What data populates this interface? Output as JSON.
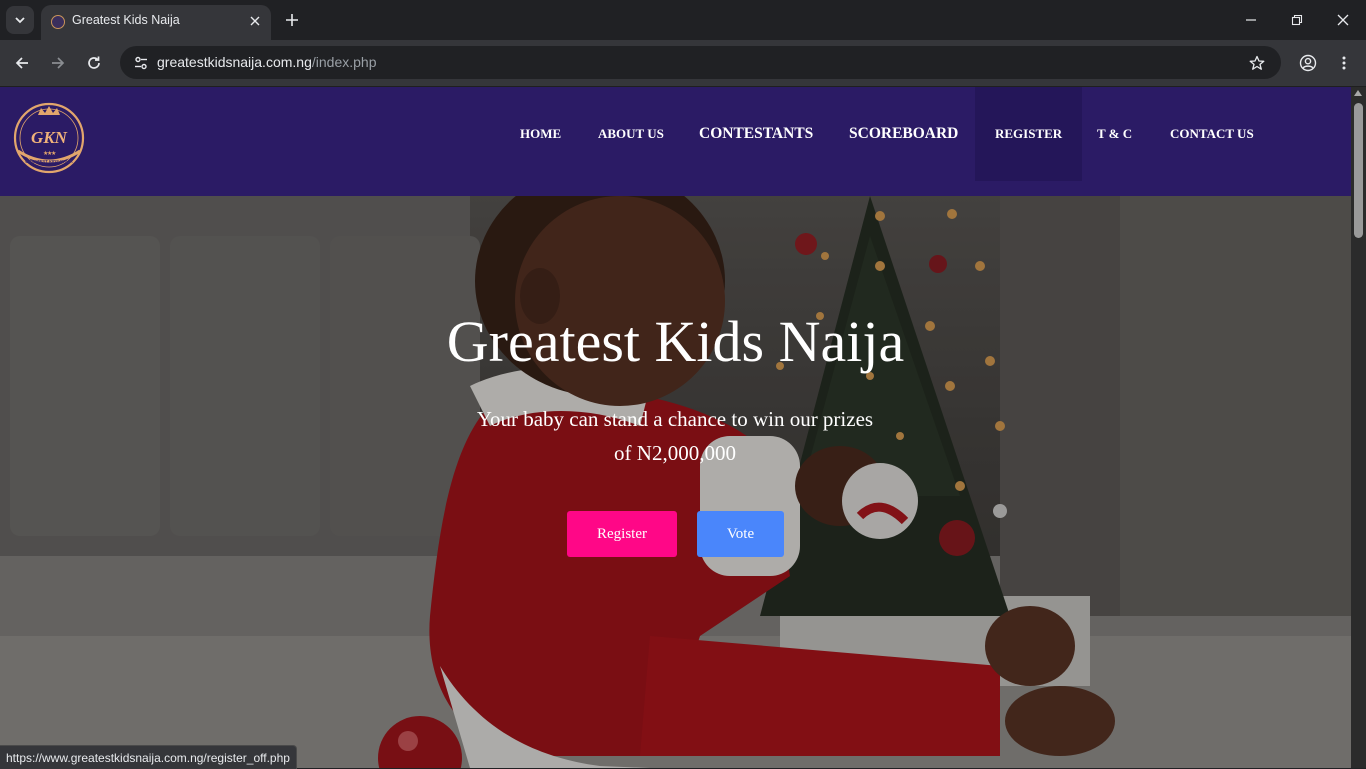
{
  "browser": {
    "tab_title": "Greatest Kids Naija",
    "url_host": "greatestkidsnaija.com.ng",
    "url_path": "/index.php",
    "status_url": "https://www.greatestkidsnaija.com.ng/register_off.php"
  },
  "site": {
    "logo_text": "GKN",
    "logo_caption": "GREATEST KIDS NAIJA",
    "nav": {
      "home": "HOME",
      "about": "ABOUT US",
      "contestants": "CONTESTANTS",
      "scoreboard": "SCOREBOARD",
      "register": "REGISTER",
      "tc": "T & C",
      "contact": "CONTACT US"
    },
    "colors": {
      "navbar": "#2b1b65",
      "register_button": "#ff0787",
      "vote_button": "#4a86fb"
    }
  },
  "hero": {
    "title": "Greatest Kids Naija",
    "subtitle": "Your baby can stand a chance to win our prizes of N2,000,000",
    "register_label": "Register",
    "vote_label": "Vote"
  }
}
